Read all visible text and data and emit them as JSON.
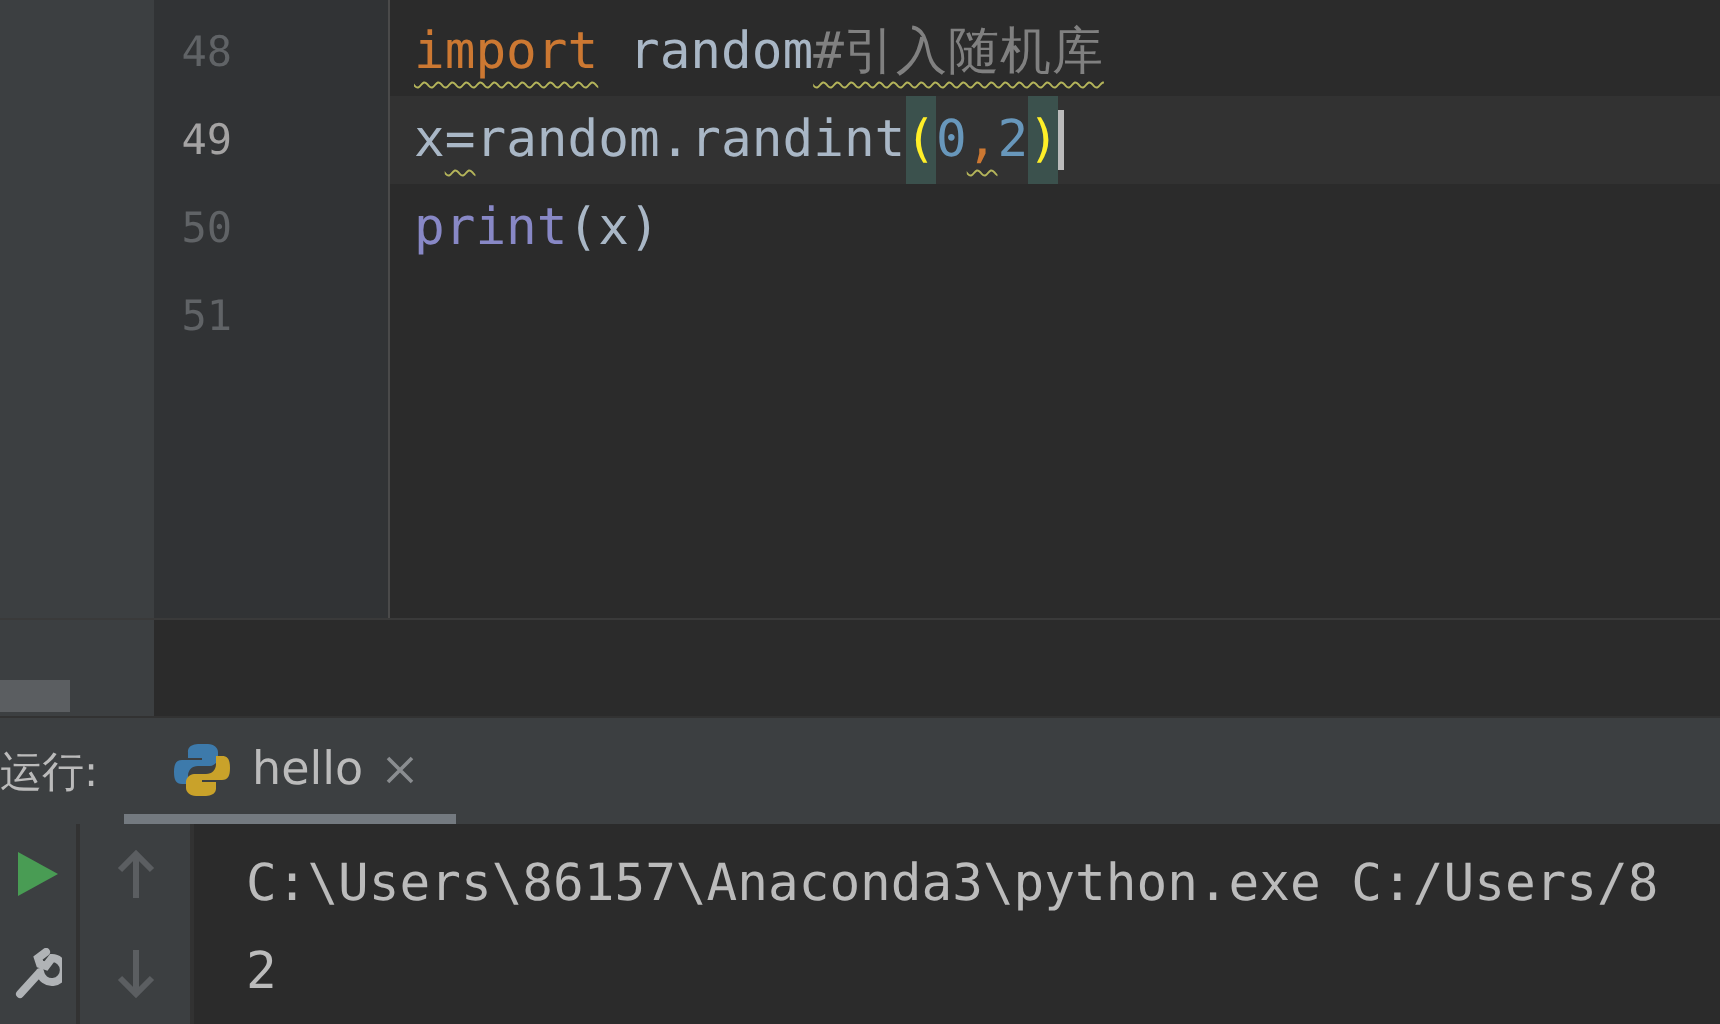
{
  "editor": {
    "lines": [
      {
        "number": "48",
        "current": false,
        "caret": false,
        "tokens": [
          {
            "text": "import",
            "kind": "keyword",
            "warning": true
          },
          {
            "text": " random",
            "kind": "plain",
            "warning": false
          },
          {
            "text": "#引入随机库",
            "kind": "comment",
            "warning": true
          }
        ]
      },
      {
        "number": "49",
        "current": true,
        "caret": true,
        "tokens": [
          {
            "text": "x",
            "kind": "plain",
            "warning": false
          },
          {
            "text": "=",
            "kind": "plain",
            "warning": true
          },
          {
            "text": "random.randint",
            "kind": "plain",
            "warning": false
          },
          {
            "text": "(",
            "kind": "brace",
            "warning": false
          },
          {
            "text": "0",
            "kind": "number",
            "warning": false
          },
          {
            "text": ",",
            "kind": "comma",
            "warning": true
          },
          {
            "text": "2",
            "kind": "number",
            "warning": false
          },
          {
            "text": ")",
            "kind": "brace",
            "warning": false
          }
        ]
      },
      {
        "number": "50",
        "current": false,
        "caret": false,
        "tokens": [
          {
            "text": "print",
            "kind": "builtin",
            "warning": false
          },
          {
            "text": "(x)",
            "kind": "plain",
            "warning": false
          }
        ]
      },
      {
        "number": "51",
        "current": false,
        "caret": false
      }
    ]
  },
  "run_panel": {
    "label": "运行:",
    "tabs": [
      {
        "label": "hello",
        "selected": true
      }
    ],
    "tools": [
      {
        "kind": "rerun",
        "disabled": false
      },
      {
        "kind": "up",
        "disabled": true
      },
      {
        "kind": "settings",
        "disabled": false
      },
      {
        "kind": "down",
        "disabled": true
      }
    ],
    "output": [
      "C:\\Users\\86157\\Anaconda3\\python.exe C:/Users/8",
      "2"
    ]
  }
}
